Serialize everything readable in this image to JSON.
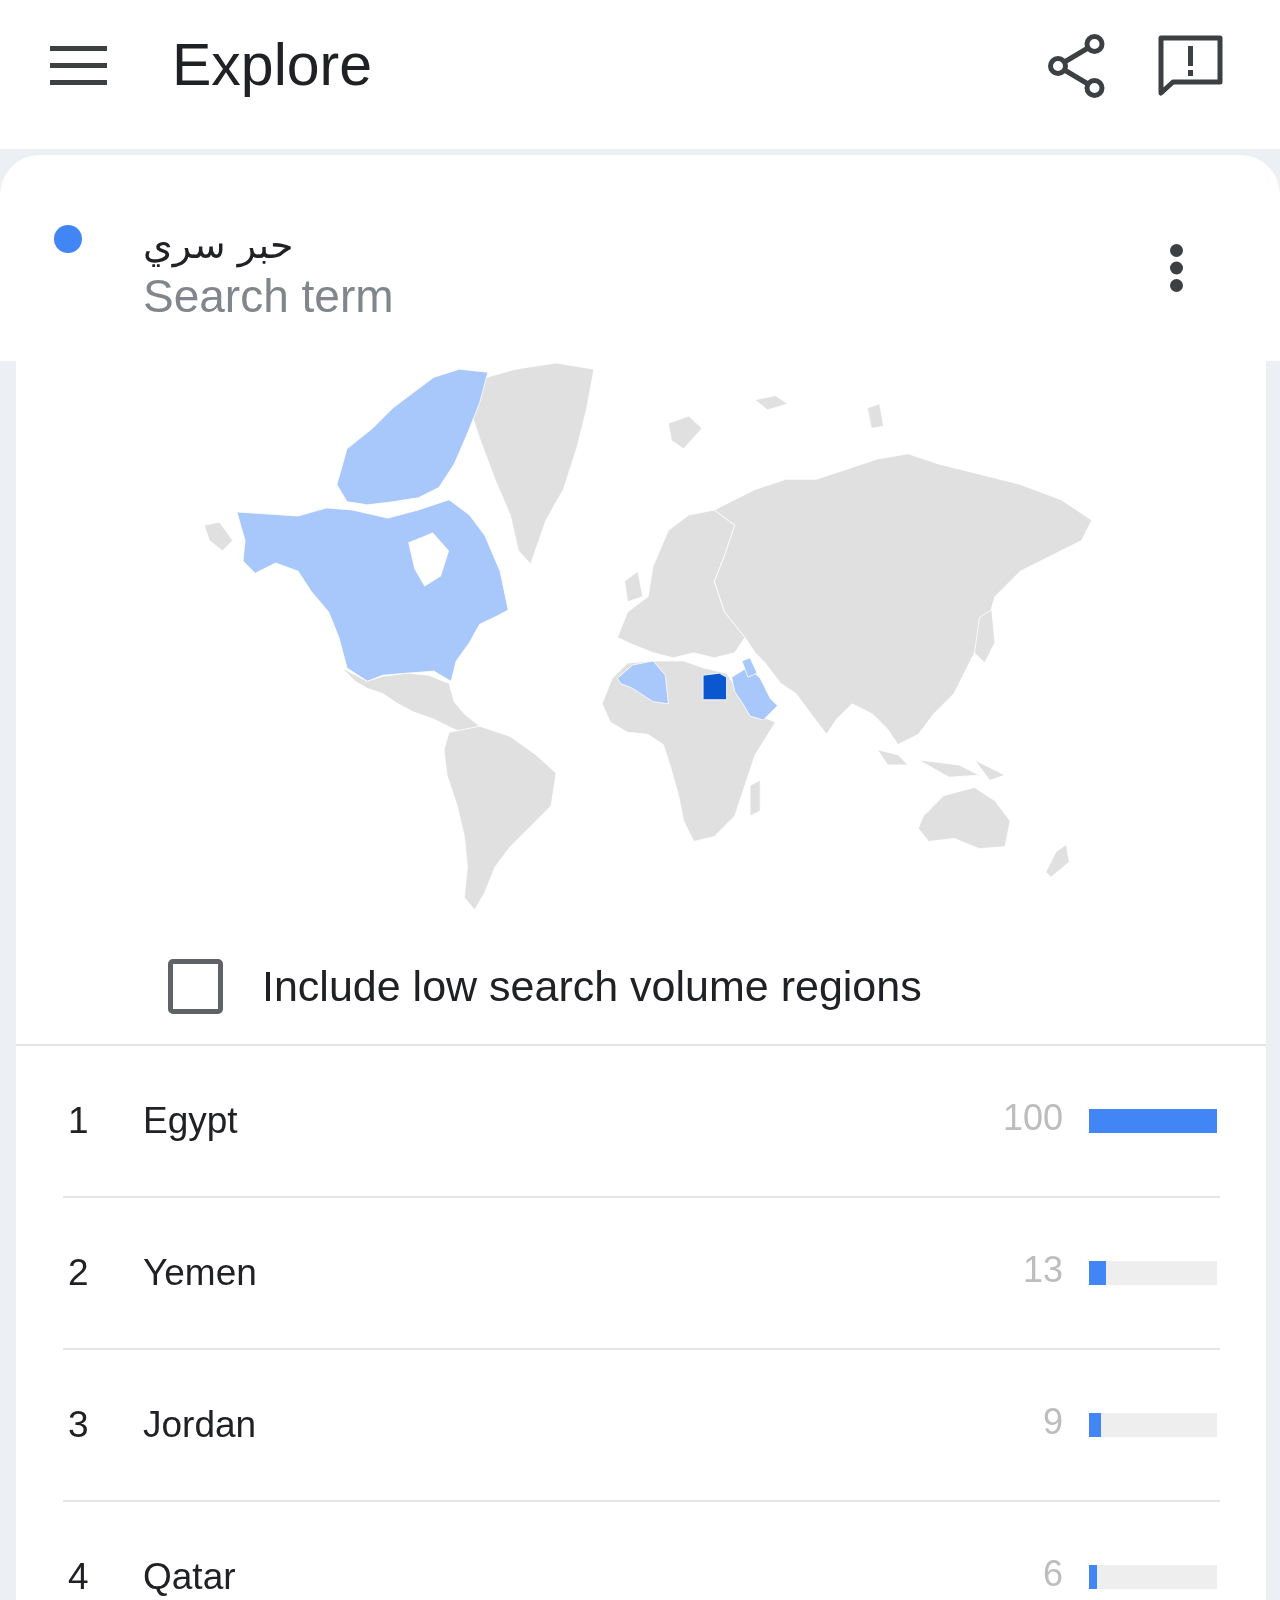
{
  "app_bar": {
    "title": "Explore"
  },
  "term": {
    "label": "حبر سري",
    "caption": "Search term",
    "color": "#4285f4"
  },
  "low_volume_option": {
    "label": "Include low search volume regions",
    "checked": false
  },
  "regions": [
    {
      "rank": "1",
      "name": "Egypt",
      "value": "100",
      "level": 1.0
    },
    {
      "rank": "2",
      "name": "Yemen",
      "value": "13",
      "level": 0.13
    },
    {
      "rank": "3",
      "name": "Jordan",
      "value": "9",
      "level": 0.09
    },
    {
      "rank": "4",
      "name": "Qatar",
      "value": "6",
      "level": 0.06
    }
  ]
}
